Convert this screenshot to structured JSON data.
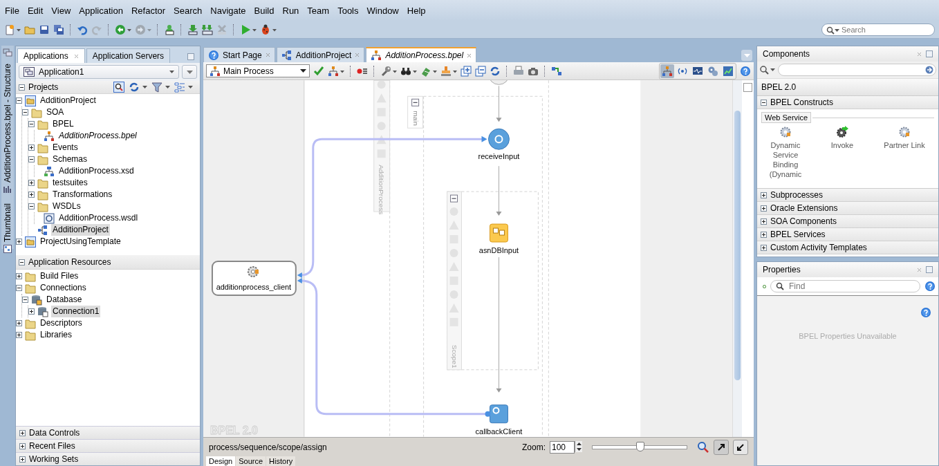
{
  "menu": [
    {
      "label": "File"
    },
    {
      "label": "Edit"
    },
    {
      "label": "View"
    },
    {
      "label": "Application"
    },
    {
      "label": "Refactor"
    },
    {
      "label": "Search"
    },
    {
      "label": "Navigate"
    },
    {
      "label": "Build"
    },
    {
      "label": "Run"
    },
    {
      "label": "Team"
    },
    {
      "label": "Tools"
    },
    {
      "label": "Window"
    },
    {
      "label": "Help"
    }
  ],
  "toolbar": {
    "buttons": [
      {
        "kind": "new",
        "disabled": false,
        "dropdown": true
      },
      {
        "kind": "open",
        "disabled": false,
        "dropdown": false
      },
      {
        "kind": "save",
        "disabled": false,
        "dropdown": false
      },
      {
        "kind": "save-all",
        "disabled": false,
        "dropdown": false
      },
      {
        "kind": "separator"
      },
      {
        "kind": "undo",
        "disabled": false,
        "dropdown": false
      },
      {
        "kind": "redo",
        "disabled": true,
        "dropdown": false
      },
      {
        "kind": "separator"
      },
      {
        "kind": "back",
        "disabled": false,
        "dropdown": true
      },
      {
        "kind": "forward",
        "disabled": true,
        "dropdown": true
      },
      {
        "kind": "separator"
      },
      {
        "kind": "sql",
        "disabled": false,
        "dropdown": false
      },
      {
        "kind": "separator"
      },
      {
        "kind": "deploy",
        "disabled": false,
        "dropdown": false
      },
      {
        "kind": "deploy-all",
        "disabled": false,
        "dropdown": false
      },
      {
        "kind": "clean",
        "disabled": true,
        "dropdown": false
      },
      {
        "kind": "separator"
      },
      {
        "kind": "run",
        "disabled": false,
        "dropdown": true
      },
      {
        "kind": "debug",
        "disabled": false,
        "dropdown": true
      }
    ],
    "search": {
      "placeholder": "Search"
    }
  },
  "side_tabs": [
    {
      "label": "AdditionProcess.bpel - Structure",
      "kind": "structure"
    },
    {
      "label": "Thumbnail",
      "kind": "thumbnail"
    }
  ],
  "applications_panel": {
    "tabs": [
      {
        "label": "Applications",
        "selected": true
      },
      {
        "label": "Application Servers",
        "selected": false
      }
    ],
    "application": "Application1",
    "projects": {
      "title": "Projects",
      "expanded": true,
      "tree": [
        {
          "label": "AdditionProject",
          "kind": "project",
          "expanded": true,
          "selected": false,
          "modified": false,
          "children": [
            {
              "label": "SOA",
              "kind": "folder",
              "expanded": true,
              "selected": false,
              "modified": false,
              "children": [
                {
                  "label": "BPEL",
                  "kind": "folder",
                  "expanded": true,
                  "selected": false,
                  "modified": false,
                  "children": [
                    {
                      "label": "AdditionProcess.bpel",
                      "kind": "bpel",
                      "selected": false,
                      "modified": true
                    }
                  ]
                },
                {
                  "label": "Events",
                  "kind": "folder",
                  "expanded": false,
                  "selected": false,
                  "modified": false
                },
                {
                  "label": "Schemas",
                  "kind": "folder",
                  "expanded": true,
                  "selected": false,
                  "modified": false,
                  "children": [
                    {
                      "label": "AdditionProcess.xsd",
                      "kind": "xsd",
                      "selected": false,
                      "modified": false
                    }
                  ]
                },
                {
                  "label": "testsuites",
                  "kind": "folder",
                  "expanded": false,
                  "selected": false,
                  "modified": false
                },
                {
                  "label": "Transformations",
                  "kind": "folder",
                  "expanded": false,
                  "selected": false,
                  "modified": false
                },
                {
                  "label": "WSDLs",
                  "kind": "folder",
                  "expanded": true,
                  "selected": false,
                  "modified": false,
                  "children": [
                    {
                      "label": "AdditionProcess.wsdl",
                      "kind": "wsdl",
                      "selected": false,
                      "modified": false
                    }
                  ]
                },
                {
                  "label": "AdditionProject",
                  "kind": "composite",
                  "selected": true,
                  "modified": false
                }
              ]
            }
          ]
        },
        {
          "label": "ProjectUsingTemplate",
          "kind": "project",
          "expanded": false,
          "selected": false,
          "modified": false
        }
      ]
    },
    "resources": {
      "title": "Application Resources",
      "expanded": true,
      "tree": [
        {
          "label": "Build Files",
          "kind": "folder",
          "expanded": false,
          "selected": false,
          "modified": false
        },
        {
          "label": "Connections",
          "kind": "folder",
          "expanded": true,
          "selected": false,
          "modified": false,
          "children": [
            {
              "label": "Database",
              "kind": "database",
              "expanded": true,
              "selected": false,
              "modified": false,
              "children": [
                {
                  "label": "Connection1",
                  "kind": "connection",
                  "expanded": false,
                  "selected": true,
                  "modified": false
                }
              ]
            }
          ]
        },
        {
          "label": "Descriptors",
          "kind": "folder",
          "expanded": false,
          "selected": false,
          "modified": false
        },
        {
          "label": "Libraries",
          "kind": "folder",
          "expanded": false,
          "selected": false,
          "modified": false
        }
      ]
    },
    "accordion": [
      {
        "label": "Data Controls",
        "expanded": false
      },
      {
        "label": "Recent Files",
        "expanded": false
      },
      {
        "label": "Working Sets",
        "expanded": false
      }
    ]
  },
  "editor": {
    "tabs": [
      {
        "label": "Start Page",
        "kind": "help",
        "selected": false,
        "modified": false
      },
      {
        "label": "AdditionProject",
        "kind": "composite",
        "selected": false,
        "modified": false
      },
      {
        "label": "AdditionProcess.bpel",
        "kind": "bpel",
        "selected": true,
        "modified": true
      }
    ],
    "process_select": "Main Process",
    "buttons": [
      {
        "kind": "validate",
        "dropdown": false
      },
      {
        "kind": "layout",
        "dropdown": true
      },
      {
        "kind": "separator"
      },
      {
        "kind": "breakpoint",
        "dropdown": false
      },
      {
        "kind": "separator"
      },
      {
        "kind": "wrench",
        "dropdown": true
      },
      {
        "kind": "binoculars",
        "dropdown": true
      },
      {
        "kind": "flag",
        "dropdown": true
      },
      {
        "kind": "stamp",
        "dropdown": true
      },
      {
        "kind": "expand",
        "dropdown": false
      },
      {
        "kind": "collapse",
        "dropdown": false
      },
      {
        "kind": "refresh",
        "dropdown": false
      },
      {
        "kind": "separator"
      },
      {
        "kind": "print",
        "dropdown": false
      },
      {
        "kind": "camera",
        "dropdown": false
      },
      {
        "kind": "separator"
      },
      {
        "kind": "connect",
        "dropdown": false
      }
    ],
    "view_buttons": [
      {
        "kind": "layout",
        "selected": true
      },
      {
        "kind": "signal",
        "selected": false
      },
      {
        "kind": "monitor",
        "selected": false
      },
      {
        "kind": "gears",
        "selected": false
      },
      {
        "kind": "chart",
        "selected": false
      }
    ],
    "diagram": {
      "partner_links": [
        {
          "label": "additionprocess_client"
        }
      ],
      "process": {
        "label": "AdditionProcess"
      },
      "main": {
        "label": "main",
        "expanded": true
      },
      "scope": {
        "label": "Scope1",
        "expanded": true
      },
      "activities": [
        {
          "kind": "receive",
          "label": "receiveInput"
        },
        {
          "kind": "assign",
          "label": "asnDBInput"
        },
        {
          "kind": "invoke",
          "label": "callbackClient"
        }
      ],
      "version_label": "BPEL 2.0"
    },
    "status_bar": {
      "path": "process/sequence/scope/assign",
      "zoom_label": "Zoom:",
      "zoom_value": "100",
      "zoom_slider": {
        "level": 0.51
      }
    },
    "bottom_tabs": [
      {
        "label": "Design",
        "selected": true
      },
      {
        "label": "Source",
        "selected": false
      },
      {
        "label": "History",
        "selected": false
      }
    ]
  },
  "components": {
    "title": "Components",
    "palette": "BPEL 2.0",
    "sections": [
      {
        "label": "BPEL Constructs",
        "expanded": true,
        "groups": [
          {
            "label": "Web Service",
            "items": [
              {
                "label": "Dynamic Service Binding (Dynamic",
                "kind": "service"
              },
              {
                "label": "Invoke",
                "kind": "invoke"
              },
              {
                "label": "Partner Link",
                "kind": "service"
              }
            ]
          }
        ]
      },
      {
        "label": "Subprocesses",
        "expanded": false
      },
      {
        "label": "Oracle Extensions",
        "expanded": false
      },
      {
        "label": "SOA Components",
        "expanded": false
      },
      {
        "label": "BPEL Services",
        "expanded": false
      },
      {
        "label": "Custom Activity Templates",
        "expanded": false
      }
    ]
  },
  "properties": {
    "title": "Properties",
    "search": {
      "placeholder": "Find"
    },
    "message": "BPEL Properties Unavailable"
  }
}
